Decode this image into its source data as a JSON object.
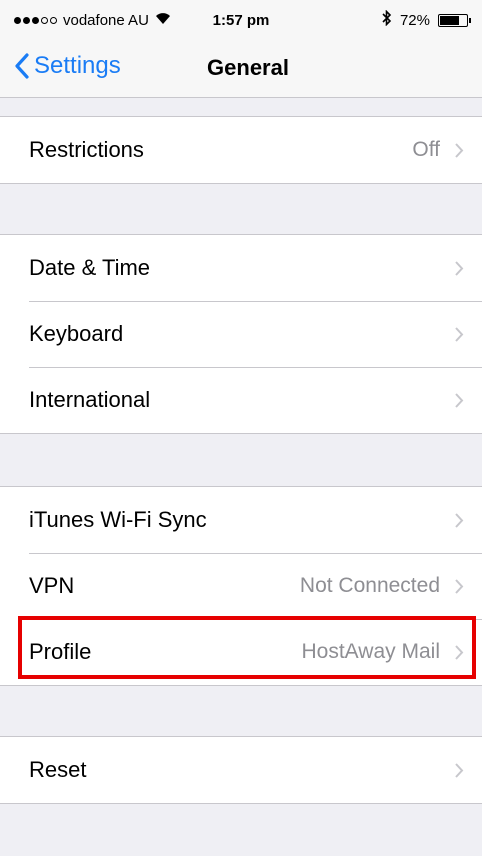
{
  "status_bar": {
    "carrier": "vodafone AU",
    "time": "1:57 pm",
    "battery": "72%",
    "battery_level": 0.72
  },
  "nav": {
    "back_label": "Settings",
    "title": "General"
  },
  "groups": [
    {
      "rows": [
        {
          "label": "Restrictions",
          "value": "Off"
        }
      ]
    },
    {
      "rows": [
        {
          "label": "Date & Time",
          "value": ""
        },
        {
          "label": "Keyboard",
          "value": ""
        },
        {
          "label": "International",
          "value": ""
        }
      ]
    },
    {
      "rows": [
        {
          "label": "iTunes Wi-Fi Sync",
          "value": ""
        },
        {
          "label": "VPN",
          "value": "Not Connected"
        },
        {
          "label": "Profile",
          "value": "HostAway Mail"
        }
      ]
    },
    {
      "rows": [
        {
          "label": "Reset",
          "value": ""
        }
      ]
    }
  ],
  "colors": {
    "accent": "#1a7cf5",
    "highlight": "#e60000",
    "background": "#efeff4"
  }
}
